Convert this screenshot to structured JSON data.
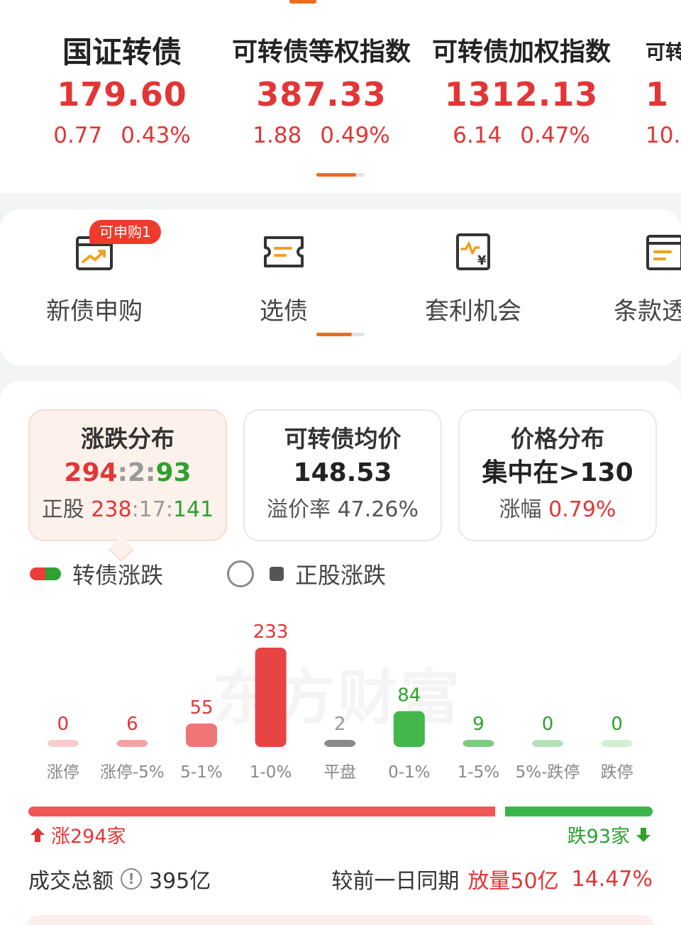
{
  "indices": [
    {
      "name": "国证转债",
      "value": "179.60",
      "change": "0.77",
      "pct": "0.43%"
    },
    {
      "name": "可转债等权指数",
      "value": "387.33",
      "change": "1.88",
      "pct": "0.49%"
    },
    {
      "name": "可转债加权指数",
      "value": "1312.13",
      "change": "6.14",
      "pct": "0.47%"
    },
    {
      "name": "可转",
      "value": "1",
      "change": "10.",
      "pct": ""
    }
  ],
  "entries": {
    "items": [
      {
        "label": "新债申购",
        "icon": "new-bond-icon"
      },
      {
        "label": "选债",
        "icon": "select-bond-icon"
      },
      {
        "label": "套利机会",
        "icon": "arbitrage-icon"
      },
      {
        "label": "条款透",
        "icon": "terms-icon"
      }
    ],
    "badge": "可申购1"
  },
  "stats": {
    "updown": {
      "title": "涨跌分布",
      "up": "294",
      "flat": "2",
      "down": "93",
      "stock_label": "正股",
      "stock_up": "238",
      "stock_flat": "17",
      "stock_down": "141"
    },
    "avg_price": {
      "title": "可转债均价",
      "value": "148.53",
      "premium_label": "溢价率",
      "premium": "47.26%"
    },
    "price_dist": {
      "title": "价格分布",
      "value": "集中在>130",
      "change_label": "涨幅",
      "change": "0.79%"
    }
  },
  "legend": {
    "bond": "转债涨跌",
    "stock": "正股涨跌"
  },
  "watermark": "东方财富",
  "colors": {
    "up": "#e33535",
    "down": "#2ea12e",
    "flat": "#888888",
    "accent": "#f06a1c"
  },
  "chart_data": {
    "type": "bar",
    "categories": [
      "涨停",
      "涨停-5%",
      "5-1%",
      "1-0%",
      "平盘",
      "0-1%",
      "1-5%",
      "5%-跌停",
      "跌停"
    ],
    "values": [
      0,
      6,
      55,
      233,
      2,
      84,
      9,
      0,
      0
    ],
    "value_labels": [
      "0",
      "6",
      "55",
      "233",
      "2",
      "84",
      "9",
      "0",
      "0"
    ],
    "directions": [
      "up",
      "up",
      "up",
      "up",
      "flat",
      "down",
      "down",
      "down",
      "down"
    ],
    "ylim": [
      0,
      233
    ]
  },
  "ratio": {
    "up_label": "涨294家",
    "down_label": "跌93家",
    "up": 294,
    "down": 93
  },
  "turnover": {
    "label": "成交总额",
    "value": "395亿",
    "compare_label": "较前一日同期",
    "volume_change": "放量50亿",
    "pct": "14.47%"
  }
}
